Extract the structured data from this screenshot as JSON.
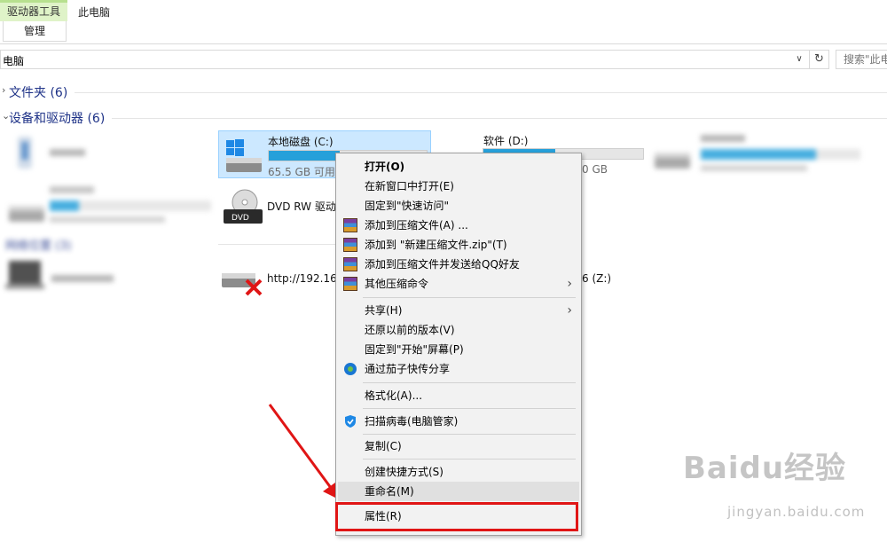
{
  "ribbon": {
    "tool_group_title": "驱动器工具",
    "tool_tab": "管理",
    "window_title": "此电脑"
  },
  "address": {
    "path": "电脑",
    "search_placeholder": "搜索\"此电"
  },
  "groups": {
    "folders": "文件夹 (6)",
    "devices": "设备和驱动器 (6)",
    "network": "网络位置 (3)"
  },
  "drives": {
    "c": {
      "name": "本地磁盘 (C:)",
      "free": "65.5 GB 可用",
      "usage": 0.45
    },
    "d": {
      "name": "软件 (D:)",
      "free": "0 GB",
      "usage": 0.45
    },
    "dvd": {
      "name": "DVD RW 驱动"
    },
    "net": {
      "name": "http://192.168"
    },
    "z": {
      "name": "6 (Z:)"
    }
  },
  "context_menu": {
    "items": [
      "打开(O)",
      "在新窗口中打开(E)",
      "固定到\"快速访问\"",
      "添加到压缩文件(A) ...",
      "添加到 \"新建压缩文件.zip\"(T)",
      "添加到压缩文件并发送给QQ好友",
      "其他压缩命令",
      "共享(H)",
      "还原以前的版本(V)",
      "固定到\"开始\"屏幕(P)",
      "通过茄子快传分享",
      "格式化(A)...",
      "扫描病毒(电脑管家)",
      "复制(C)",
      "创建快捷方式(S)",
      "重命名(M)",
      "属性(R)"
    ]
  },
  "watermark": {
    "brand": "Baidu经验",
    "url": "jingyan.baidu.com"
  },
  "colors": {
    "accent": "#26a0da",
    "group_header": "#1e3287",
    "highlight_box": "#e01515",
    "tool_tab_bg": "#dff3c8"
  }
}
